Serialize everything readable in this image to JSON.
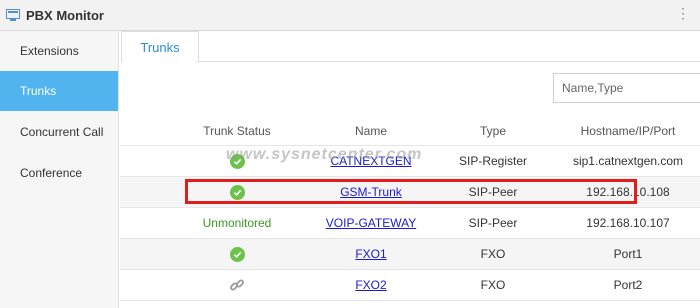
{
  "window": {
    "title": "PBX Monitor"
  },
  "sidebar": {
    "items": [
      {
        "label": "Extensions"
      },
      {
        "label": "Trunks"
      },
      {
        "label": "Concurrent Call"
      },
      {
        "label": "Conference"
      }
    ]
  },
  "tabs": [
    {
      "label": "Trunks"
    }
  ],
  "search": {
    "placeholder": "Name,Type"
  },
  "table": {
    "headers": [
      "Trunk Status",
      "Name",
      "Type",
      "Hostname/IP/Port"
    ],
    "rows": [
      {
        "status": "check-icon",
        "status_text": "",
        "name": "CATNEXTGEN",
        "type": "SIP-Register",
        "host": "sip1.catnextgen.com"
      },
      {
        "status": "check-icon",
        "status_text": "",
        "name": "GSM-Trunk",
        "type": "SIP-Peer",
        "host": "192.168.10.108"
      },
      {
        "status": "text",
        "status_text": "Unmonitored",
        "name": "VOIP-GATEWAY",
        "type": "SIP-Peer",
        "host": "192.168.10.107"
      },
      {
        "status": "check-icon",
        "status_text": "",
        "name": "FXO1",
        "type": "FXO",
        "host": "Port1"
      },
      {
        "status": "link-icon",
        "status_text": "",
        "name": "FXO2",
        "type": "FXO",
        "host": "Port2"
      }
    ]
  },
  "watermark": "www.sysnetcenter.com",
  "colors": {
    "accent": "#52b4ee",
    "tab_text": "#2b8fd6",
    "link": "#1a1ad0",
    "ok": "#6cc24a",
    "unmonitored": "#3a9a25",
    "highlight": "#e01e1e"
  }
}
